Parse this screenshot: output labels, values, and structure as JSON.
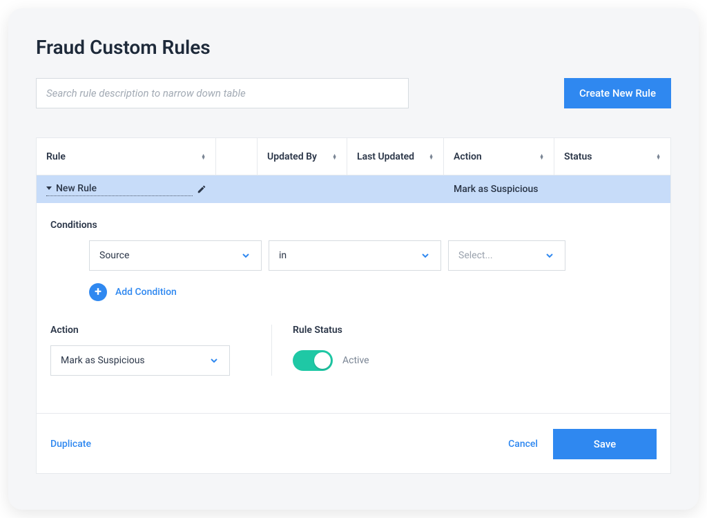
{
  "title": "Fraud Custom Rules",
  "search_placeholder": "Search rule description to narrow down table",
  "create_button": "Create New Rule",
  "columns": {
    "rule": "Rule",
    "updated_by": "Updated By",
    "last_updated": "Last Updated",
    "action": "Action",
    "status": "Status"
  },
  "row": {
    "name": "New Rule",
    "updated_by": "",
    "last_updated": "",
    "action": "Mark as Suspicious",
    "status": ""
  },
  "editor": {
    "conditions_label": "Conditions",
    "condition": {
      "field": "Source",
      "operator": "in",
      "value_placeholder": "Select..."
    },
    "add_condition": "Add Condition",
    "action_label": "Action",
    "action_value": "Mark as Suspicious",
    "status_label": "Rule Status",
    "status_value": "Active",
    "status_on": true
  },
  "footer": {
    "duplicate": "Duplicate",
    "cancel": "Cancel",
    "save": "Save"
  }
}
